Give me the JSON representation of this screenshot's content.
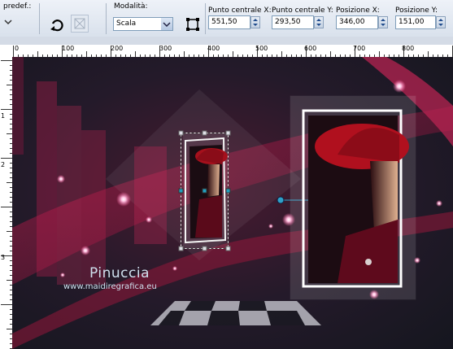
{
  "toolbar": {
    "preset_label": "predef.:",
    "mode_label": "Modalità:",
    "mode_value": "Scala",
    "center_x_label": "Punto centrale X:",
    "center_x_value": "551,50",
    "center_y_label": "Punto centrale Y:",
    "center_y_value": "293,50",
    "pos_x_label": "Posizione X:",
    "pos_x_value": "346,00",
    "pos_y_label": "Posizione Y:",
    "pos_y_value": "151,00"
  },
  "ruler_h": [
    "0",
    "100",
    "200",
    "300",
    "400",
    "500",
    "600",
    "700",
    "800"
  ],
  "ruler_v": [
    "1",
    "2",
    "3"
  ],
  "canvas": {
    "watermark_name": "Pinuccia",
    "watermark_url": "www.maidiregrafica.eu"
  },
  "colors": {
    "bg_dark": "#1a1a26",
    "magenta": "#c0204a",
    "hat_red": "#a0101c"
  }
}
